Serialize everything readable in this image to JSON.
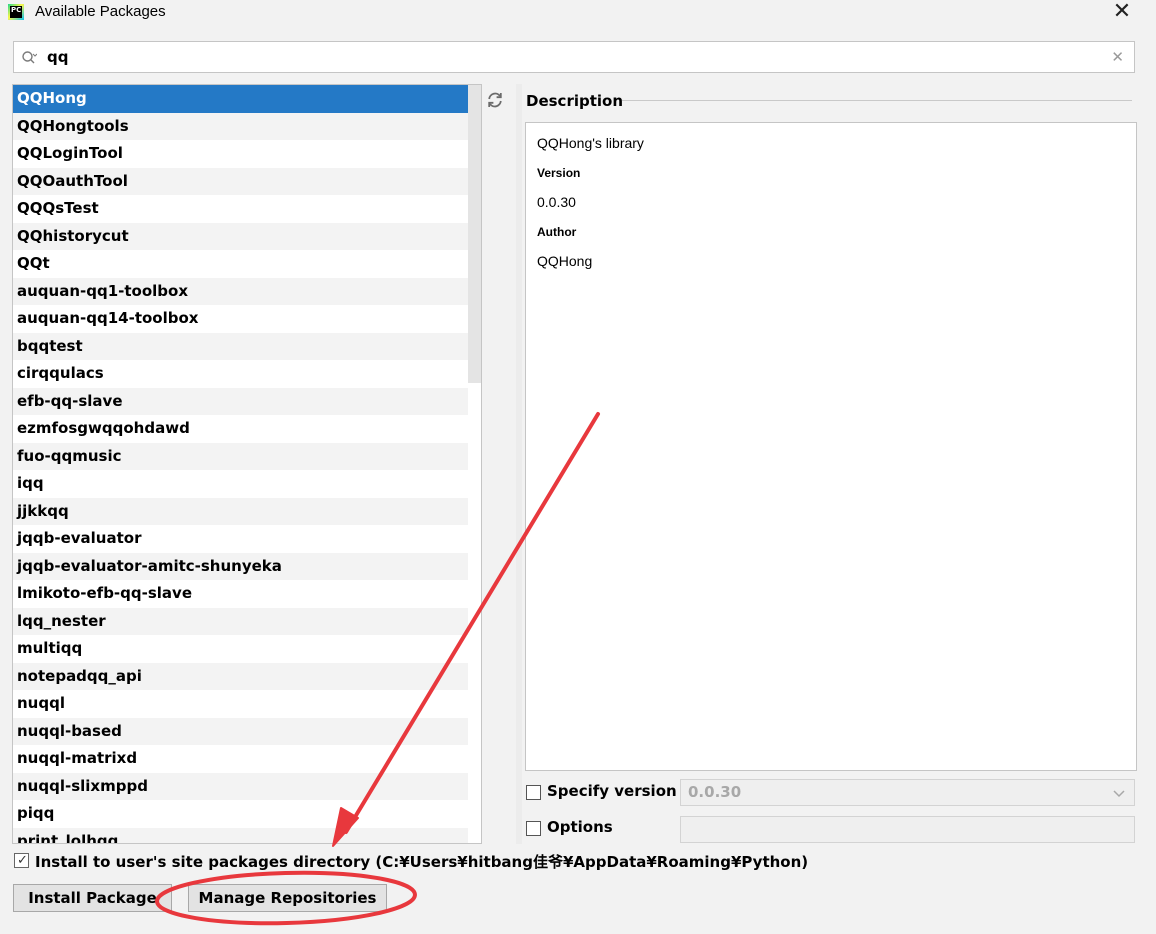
{
  "window": {
    "title": "Available Packages",
    "app_icon_text": "PC"
  },
  "search": {
    "value": "qq"
  },
  "packages": [
    "QQHong",
    "QQHongtools",
    "QQLoginTool",
    "QQOauthTool",
    "QQQsTest",
    "QQhistorycut",
    "QQt",
    "auquan-qq1-toolbox",
    "auquan-qq14-toolbox",
    "bqqtest",
    "cirqqulacs",
    "efb-qq-slave",
    "ezmfosgwqqohdawd",
    "fuo-qqmusic",
    "iqq",
    "jjkkqq",
    "jqqb-evaluator",
    "jqqb-evaluator-amitc-shunyeka",
    "lmikoto-efb-qq-slave",
    "lqq_nester",
    "multiqq",
    "notepadqq_api",
    "nuqql",
    "nuqql-based",
    "nuqql-matrixd",
    "nuqql-slixmppd",
    "piqq",
    "print_lolhqq"
  ],
  "selected_index": 0,
  "description": {
    "label": "Description",
    "summary": "QQHong's library",
    "version_label": "Version",
    "version": "0.0.30",
    "author_label": "Author",
    "author": "QQHong"
  },
  "specify_version": {
    "label": "Specify version",
    "checked": false,
    "value": "0.0.30"
  },
  "options": {
    "label": "Options",
    "checked": false
  },
  "install_user": {
    "label": "Install to user's site packages directory (C:¥Users¥hitbang佳爷¥AppData¥Roaming¥Python)",
    "checked": true
  },
  "buttons": {
    "install": "Install Package",
    "manage": "Manage Repositories"
  },
  "colors": {
    "selection": "#2479c6",
    "annotation": "#e8383d"
  }
}
